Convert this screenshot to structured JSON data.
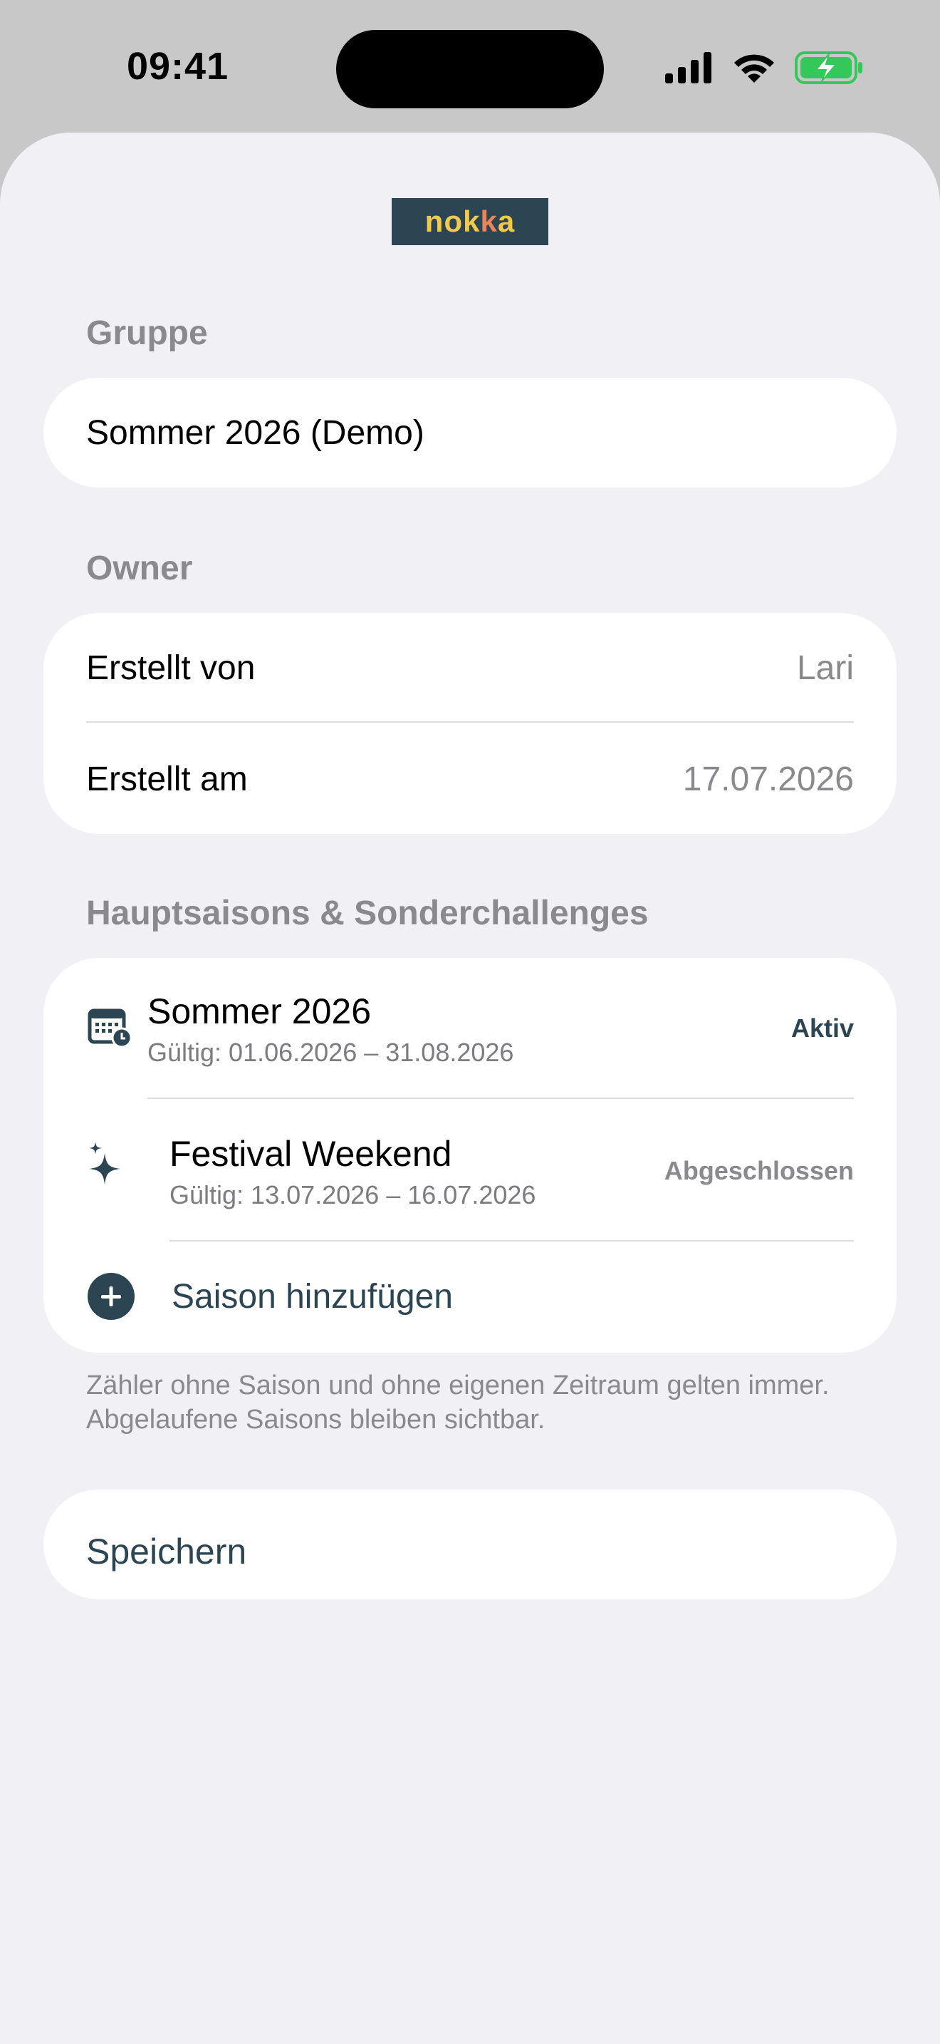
{
  "status_bar": {
    "time": "09:41",
    "icons": [
      "signal-icon",
      "wifi-icon",
      "battery-charging-icon"
    ]
  },
  "logo": {
    "part1": "nok",
    "part2": "k",
    "part3": "a"
  },
  "group_section": {
    "title": "Gruppe",
    "name_value": "Sommer 2026 (Demo)"
  },
  "owner_section": {
    "title": "Owner",
    "created_by_label": "Erstellt von",
    "created_by_value": "Lari",
    "created_at_label": "Erstellt am",
    "created_at_value": "17.07.2026"
  },
  "seasons_section": {
    "title": "Hauptsaisons & Sonderchallenges",
    "seasons": [
      {
        "name": "Sommer 2026",
        "validity": "Gültig: 01.06.2026 – 31.08.2026",
        "status": "Aktiv",
        "icon": "calendar-clock-icon"
      },
      {
        "name": "Festival Weekend",
        "validity": "Gültig: 13.07.2026 – 16.07.2026",
        "status": "Abgeschlossen",
        "icon": "sparkles-icon"
      }
    ],
    "add_label": "Saison hinzufügen",
    "footnote": "Zähler ohne Saison und ohne eigenen Zeitraum gelten immer. Abgelaufene Saisons bleiben sichtbar."
  },
  "save_button": {
    "label": "Speichern"
  },
  "colors": {
    "accent": "#2c4552",
    "background": "#f0f0f5",
    "secondary_text": "#8a8a8e",
    "battery_green": "#34c759"
  }
}
